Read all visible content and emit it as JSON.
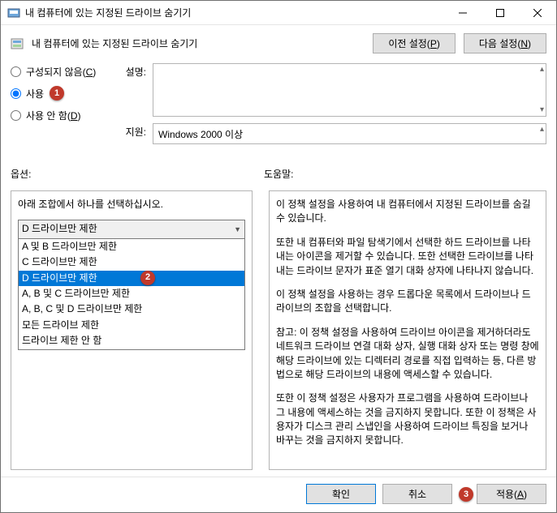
{
  "window": {
    "title": "내 컴퓨터에 있는 지정된 드라이브 숨기기"
  },
  "header": {
    "title": "내 컴퓨터에 있는 지정된 드라이브 숨기기",
    "prev_label": "이전 설정(",
    "prev_accel": "P",
    "prev_label_end": ")",
    "next_label": "다음 설정(",
    "next_accel": "N",
    "next_label_end": ")"
  },
  "radios": {
    "not_configured": "구성되지 않음(",
    "not_configured_accel": "C",
    "not_configured_end": ")",
    "enabled": "사용",
    "disabled": "사용 안 함(",
    "disabled_accel": "D",
    "disabled_end": ")"
  },
  "badges": {
    "b1": "1",
    "b2": "2",
    "b3": "3"
  },
  "fields": {
    "desc_label": "설명:",
    "support_label": "지원:",
    "support_value": "Windows 2000 이상"
  },
  "section_labels": {
    "options": "옵션:",
    "help": "도움말:"
  },
  "options_panel": {
    "instruction": "아래 조합에서 하나를 선택하십시오.",
    "selected": "D 드라이브만 제한",
    "items": [
      "A 및 B 드라이브만 제한",
      "C 드라이브만 제한",
      "D 드라이브만 제한",
      "A, B 및 C 드라이브만 제한",
      "A, B, C 및 D 드라이브만 제한",
      "모든 드라이브 제한",
      "드라이브 제한 안 함"
    ],
    "selected_index": 2
  },
  "help_panel": {
    "p1": "이 정책 설정을 사용하여 내 컴퓨터에서 지정된 드라이브를 숨길 수 있습니다.",
    "p2": "또한 내 컴퓨터와 파일 탐색기에서 선택한 하드 드라이브를 나타내는 아이콘을 제거할 수 있습니다. 또한 선택한 드라이브를 나타내는 드라이브 문자가 표준 열기 대화 상자에 나타나지 않습니다.",
    "p3": "이 정책 설정을 사용하는 경우 드롭다운 목록에서 드라이브나 드라이브의 조합을 선택합니다.",
    "p4": "참고: 이 정책 설정을 사용하여 드라이브 아이콘을 제거하더라도 네트워크 드라이브 연결 대화 상자, 실행 대화 상자 또는 명령 창에 해당 드라이브에 있는 디렉터리 경로를 직접 입력하는 등, 다른 방법으로 해당 드라이브의 내용에 액세스할 수 있습니다.",
    "p5": "또한 이 정책 설정은 사용자가 프로그램을 사용하여 드라이브나 그 내용에 액세스하는 것을 금지하지 못합니다. 또한 이 정책은 사용자가 디스크 관리 스냅인을 사용하여 드라이브 특징을 보거나 바꾸는 것을 금지하지 못합니다."
  },
  "footer": {
    "ok": "확인",
    "cancel": "취소",
    "apply": "적용(",
    "apply_accel": "A",
    "apply_end": ")"
  }
}
